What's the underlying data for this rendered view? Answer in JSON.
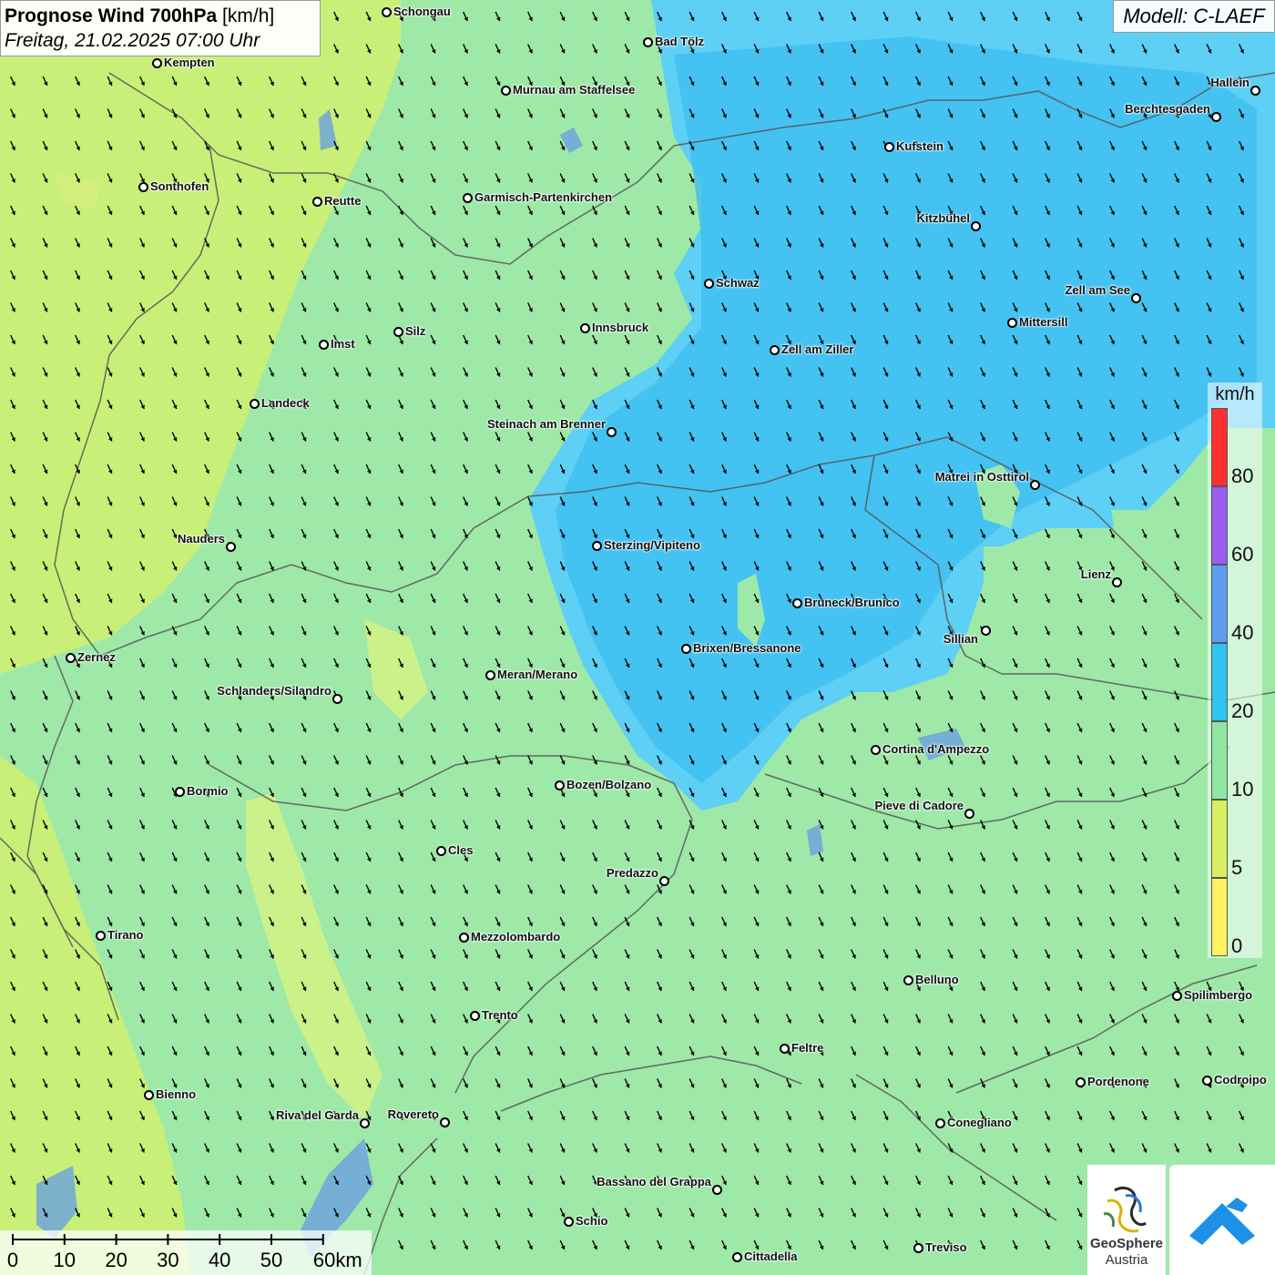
{
  "title": {
    "main": "Prognose Wind 700hPa",
    "unit": "[km/h]",
    "subtitle": "Freitag, 21.02.2025 07:00 Uhr"
  },
  "model_label": "Modell: C-LAEF",
  "legend": {
    "unit": "km/h",
    "ticks": [
      "80",
      "60",
      "40",
      "20",
      "10",
      "5",
      "0"
    ],
    "colors": [
      "#ff3030",
      "#9b5cf0",
      "#5f9df0",
      "#30c4f0",
      "#8ee6a0",
      "#d7f060",
      "#fff160"
    ]
  },
  "wind": {
    "direction_deg_from": 335,
    "speed_range_kmh": [
      5,
      40
    ]
  },
  "scale_bar": {
    "labels": [
      "0",
      "10",
      "20",
      "30",
      "40",
      "50",
      "60km"
    ]
  },
  "logos": {
    "geosphere_line1": "GeoSphere",
    "geosphere_line2": "Austria"
  },
  "colors": {
    "zone_yellowgreen": "#c8ef78",
    "zone_green": "#9ee8a8",
    "zone_cyan": "#5ecff5",
    "zone_blue": "#34b8ee",
    "border": "#555555",
    "water": "#6aa0e0"
  },
  "cities": [
    {
      "name": "Schongau"
    },
    {
      "name": "Bad Tölz"
    },
    {
      "name": "Kempten"
    },
    {
      "name": "Murnau am Staffelsee"
    },
    {
      "name": "Hallein"
    },
    {
      "name": "Berchtesgaden"
    },
    {
      "name": "Kufstein"
    },
    {
      "name": "Sonthofen"
    },
    {
      "name": "Reutte"
    },
    {
      "name": "Garmisch-Partenkirchen"
    },
    {
      "name": "Kitzbühel"
    },
    {
      "name": "Schwaz"
    },
    {
      "name": "Zell am See"
    },
    {
      "name": "Mittersill"
    },
    {
      "name": "Innsbruck"
    },
    {
      "name": "Silz"
    },
    {
      "name": "Imst"
    },
    {
      "name": "Zell am Ziller"
    },
    {
      "name": "Landeck"
    },
    {
      "name": "Steinach am Brenner"
    },
    {
      "name": "Matrei in Osttirol"
    },
    {
      "name": "Nauders"
    },
    {
      "name": "Sterzing/Vipiteno"
    },
    {
      "name": "Lienz"
    },
    {
      "name": "Bruneck/Brunico"
    },
    {
      "name": "Sillian"
    },
    {
      "name": "Brixen/Bressanone"
    },
    {
      "name": "Zernez"
    },
    {
      "name": "Meran/Merano"
    },
    {
      "name": "Schlanders/Silandro"
    },
    {
      "name": "Cortina d'Ampezzo"
    },
    {
      "name": "Bozen/Bolzano"
    },
    {
      "name": "Bormio"
    },
    {
      "name": "Pieve di Cadore"
    },
    {
      "name": "Cles"
    },
    {
      "name": "Predazzo"
    },
    {
      "name": "Tirano"
    },
    {
      "name": "Mezzolombardo"
    },
    {
      "name": "Belluno"
    },
    {
      "name": "Spilimbergo"
    },
    {
      "name": "Trento"
    },
    {
      "name": "Feltre"
    },
    {
      "name": "Pordenone"
    },
    {
      "name": "Codroipo"
    },
    {
      "name": "Bienno"
    },
    {
      "name": "Riva del Garda"
    },
    {
      "name": "Rovereto"
    },
    {
      "name": "Conegliano"
    },
    {
      "name": "Bassano del Grappa"
    },
    {
      "name": "Schio"
    },
    {
      "name": "Treviso"
    },
    {
      "name": "Cittadella"
    }
  ]
}
